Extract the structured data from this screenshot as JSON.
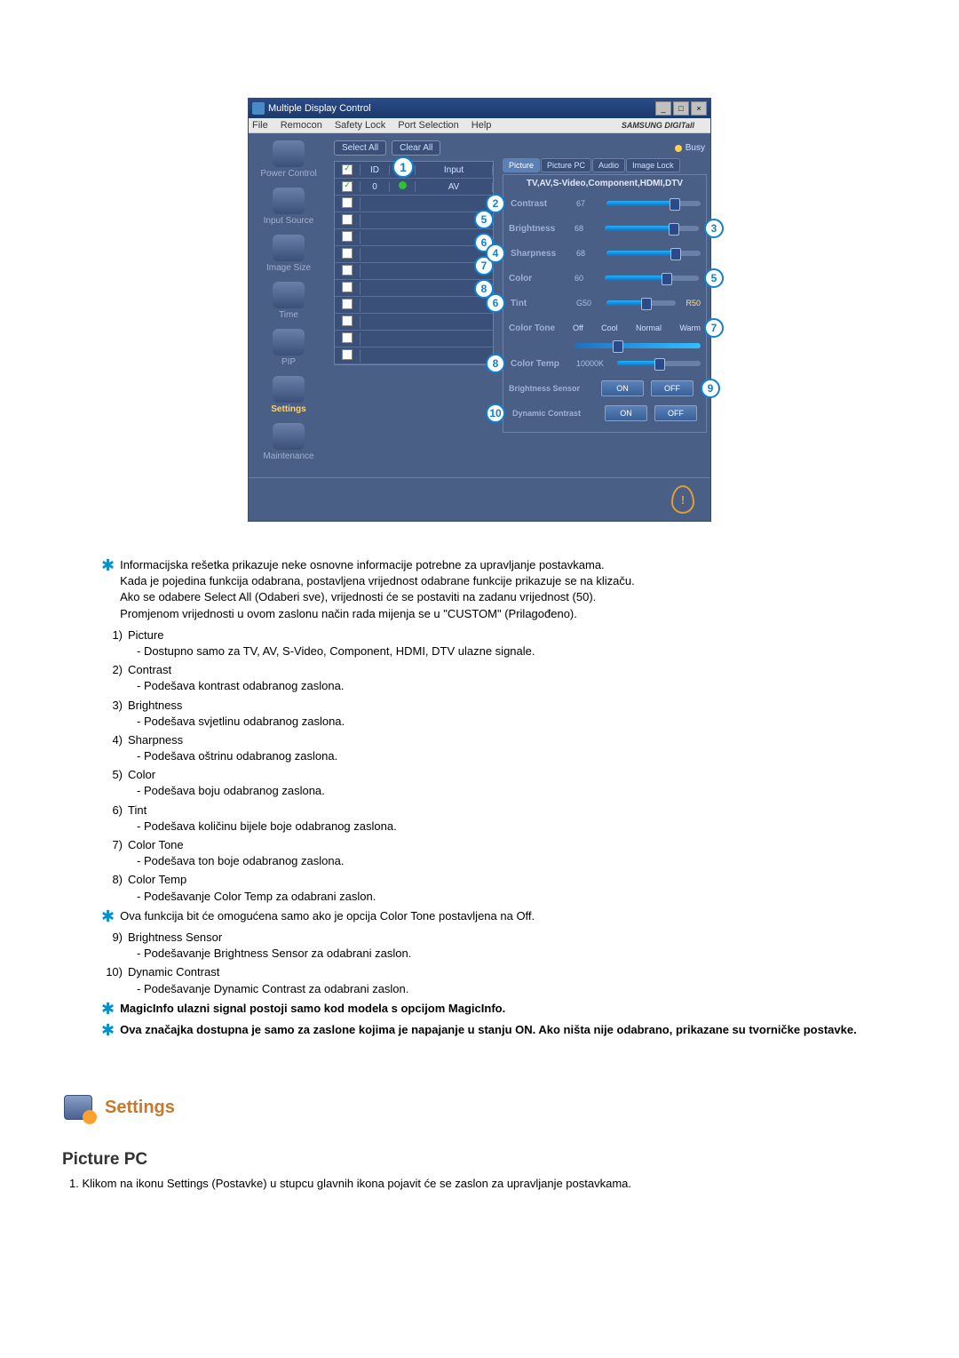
{
  "app": {
    "title": "Multiple Display Control",
    "menubar": [
      "File",
      "Remocon",
      "Safety Lock",
      "Port Selection",
      "Help"
    ],
    "brand": "SAMSUNG DIGITall"
  },
  "sidebar": {
    "items": [
      {
        "label": "Power Control"
      },
      {
        "label": "Input Source"
      },
      {
        "label": "Image Size"
      },
      {
        "label": "Time"
      },
      {
        "label": "PIP"
      },
      {
        "label": "Settings"
      },
      {
        "label": "Maintenance"
      }
    ]
  },
  "toolbar": {
    "select_all": "Select All",
    "clear_all": "Clear All",
    "busy": "Busy"
  },
  "grid": {
    "headers": {
      "id": "ID",
      "input": "Input"
    },
    "row": {
      "id": "0",
      "input": "AV"
    }
  },
  "tabs": [
    "Picture",
    "Picture PC",
    "Audio",
    "Image Lock"
  ],
  "panel": {
    "sources": "TV,AV,S-Video,Component,HDMI,DTV",
    "contrast": {
      "label": "Contrast",
      "val": "67"
    },
    "brightness": {
      "label": "Brightness",
      "val": "68"
    },
    "sharpness": {
      "label": "Sharpness",
      "val": "68"
    },
    "color": {
      "label": "Color",
      "val": "60"
    },
    "tint": {
      "label": "Tint",
      "left": "G50",
      "right": "R50"
    },
    "color_tone": {
      "label": "Color Tone",
      "opts": [
        "Off",
        "Cool",
        "Normal",
        "Warm"
      ]
    },
    "color_temp": {
      "label": "Color Temp",
      "val": "10000K"
    },
    "bsensor": {
      "label": "Brightness Sensor",
      "on": "ON",
      "off": "OFF"
    },
    "dcontrast": {
      "label": "Dynamic Contrast",
      "on": "ON",
      "off": "OFF"
    }
  },
  "callouts": {
    "c1": "1",
    "c2": "2",
    "c3": "3",
    "c4": "4",
    "c5": "5",
    "c6": "6",
    "c7": "7",
    "c8": "8",
    "c9": "9",
    "c10": "10"
  },
  "desc": {
    "star1": [
      "Informacijska rešetka prikazuje neke osnovne informacije potrebne za upravljanje postavkama.",
      "Kada je pojedina funkcija odabrana, postavljena vrijednost odabrane funkcije prikazuje se na klizaču.",
      "Ako se odabere Select All (Odaberi sve), vrijednosti će se postaviti na zadanu vrijednost (50).",
      "Promjenom vrijednosti u ovom zaslonu način rada mijenja se u \"CUSTOM\" (Prilagođeno)."
    ],
    "items": [
      {
        "n": "1)",
        "t": "Picture",
        "d": "- Dostupno samo za TV, AV, S-Video, Component, HDMI, DTV ulazne signale."
      },
      {
        "n": "2)",
        "t": "Contrast",
        "d": "- Podešava kontrast odabranog zaslona."
      },
      {
        "n": "3)",
        "t": "Brightness",
        "d": "- Podešava svjetlinu odabranog zaslona."
      },
      {
        "n": "4)",
        "t": "Sharpness",
        "d": "- Podešava oštrinu odabranog zaslona."
      },
      {
        "n": "5)",
        "t": "Color",
        "d": "- Podešava boju odabranog zaslona."
      },
      {
        "n": "6)",
        "t": "Tint",
        "d": "- Podešava količinu bijele boje odabranog zaslona."
      },
      {
        "n": "7)",
        "t": "Color Tone",
        "d": "- Podešava ton boje odabranog zaslona."
      },
      {
        "n": "8)",
        "t": "Color Temp",
        "d": "- Podešavanje Color Temp za odabrani zaslon."
      }
    ],
    "star2": "Ova funkcija bit će omogućena samo ako je opcija Color Tone postavljena na Off.",
    "items2": [
      {
        "n": "9)",
        "t": "Brightness Sensor",
        "d": "- Podešavanje Brightness Sensor za odabrani zaslon."
      },
      {
        "n": "10)",
        "t": "Dynamic Contrast",
        "d": "- Podešavanje Dynamic Contrast za odabrani zaslon."
      }
    ],
    "star3": "MagicInfo ulazni signal postoji samo kod modela s opcijom MagicInfo.",
    "star4": "Ova značajka dostupna je samo za zaslone kojima je napajanje u stanju ON. Ako ništa nije odabrano, prikazane su tvorničke postavke."
  },
  "settings_section": {
    "heading": "Settings",
    "sub_heading": "Picture PC",
    "line": "1. Klikom na ikonu Settings (Postavke) u stupcu glavnih ikona pojavit će se zaslon za upravljanje postavkama."
  }
}
